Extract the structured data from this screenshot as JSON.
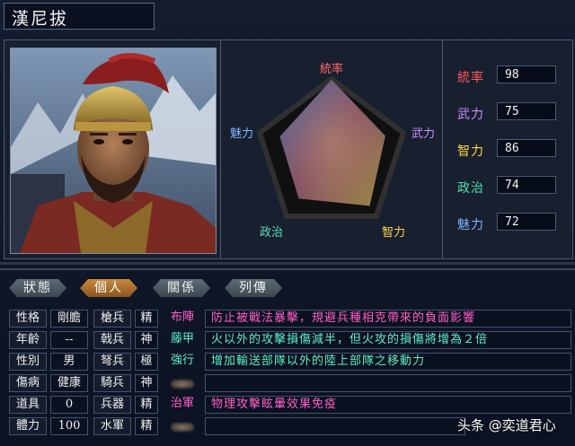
{
  "header": {
    "title": "漢尼拔"
  },
  "radar": {
    "labels": {
      "top": "統率",
      "right": "武力",
      "bottom_right": "智力",
      "bottom_left": "政治",
      "left": "魅力"
    },
    "label_colors": {
      "top": "#ff6a6a",
      "right": "#c98cff",
      "bottom_right": "#ffd34a",
      "bottom_left": "#5adfbd",
      "left": "#7fb6ff"
    }
  },
  "stats": [
    {
      "label": "統率",
      "value": "98",
      "color": "#ff5a5a"
    },
    {
      "label": "武力",
      "value": "75",
      "color": "#c88cff"
    },
    {
      "label": "智力",
      "value": "86",
      "color": "#ffd34a"
    },
    {
      "label": "政治",
      "value": "74",
      "color": "#4fe0a8"
    },
    {
      "label": "魅力",
      "value": "72",
      "color": "#7fb0ff"
    }
  ],
  "tabs": [
    {
      "label": "狀態",
      "active": false
    },
    {
      "label": "個人",
      "active": true
    },
    {
      "label": "關係",
      "active": false
    },
    {
      "label": "列傳",
      "active": false
    }
  ],
  "profile": [
    {
      "label": "性格",
      "value": "剛膽"
    },
    {
      "label": "年齡",
      "value": "--"
    },
    {
      "label": "性別",
      "value": "男"
    },
    {
      "label": "傷病",
      "value": "健康"
    },
    {
      "label": "道具",
      "value": "0"
    },
    {
      "label": "體力",
      "value": "100"
    }
  ],
  "aptitude": [
    {
      "label": "槍兵",
      "value": "精"
    },
    {
      "label": "戟兵",
      "value": "神"
    },
    {
      "label": "弩兵",
      "value": "極"
    },
    {
      "label": "騎兵",
      "value": "神"
    },
    {
      "label": "兵器",
      "value": "精"
    },
    {
      "label": "水軍",
      "value": "精"
    }
  ],
  "skills": [
    {
      "name": "布陣",
      "desc": "防止被戰法暴擊，規避兵種相克帶來的負面影響",
      "color": "#ff5fc8"
    },
    {
      "name": "藤甲",
      "desc": "火以外的攻擊損傷減半，但火攻的損傷將增為２倍",
      "color": "#5ef0c8"
    },
    {
      "name": "強行",
      "desc": "增加輸送部隊以外的陸上部隊之移動力",
      "color": "#5ef0c8"
    },
    {
      "name": "",
      "desc": "",
      "color": "#ffffff"
    },
    {
      "name": "治軍",
      "desc": "物理攻擊眩暈效果免疫",
      "color": "#ff5fc8"
    },
    {
      "name": "",
      "desc": "",
      "color": "#ffffff"
    }
  ],
  "watermark": {
    "text": "头条 @奕道君心"
  }
}
